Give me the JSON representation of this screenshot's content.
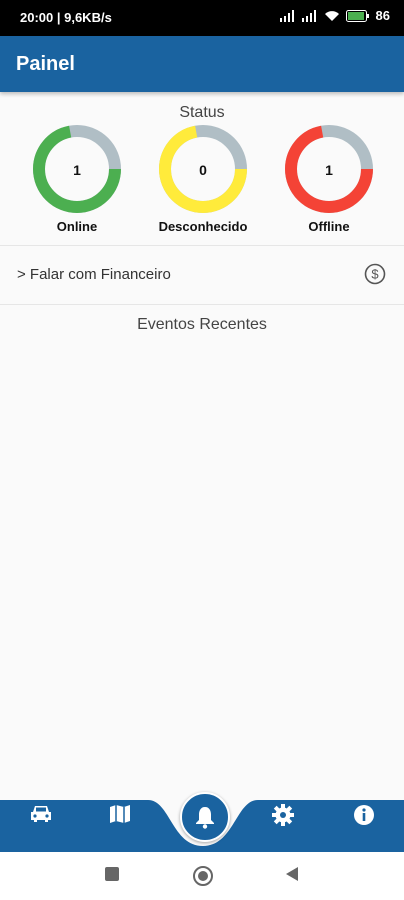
{
  "status_bar": {
    "time": "20:00 | 9,6KB/s",
    "battery": "86"
  },
  "app_bar": {
    "title": "Painel"
  },
  "status_section": {
    "label": "Status",
    "items": [
      {
        "label": "Online",
        "count": "1",
        "color": "#4caf50",
        "fraction": 0.72
      },
      {
        "label": "Desconhecido",
        "count": "0",
        "color": "#ffeb3b",
        "fraction": 0.72
      },
      {
        "label": "Offline",
        "count": "1",
        "color": "#f44336",
        "fraction": 0.72
      }
    ],
    "track_color": "#b0bec5"
  },
  "finance": {
    "text": "> Falar com Financeiro",
    "icon": "dollar-circle-icon"
  },
  "events": {
    "title": "Eventos Recentes"
  },
  "bottom_nav": {
    "background": "#1a63a0",
    "items": [
      {
        "icon": "car-icon"
      },
      {
        "icon": "map-icon"
      },
      {
        "icon": "bell-icon"
      },
      {
        "icon": "gear-icon"
      },
      {
        "icon": "info-icon"
      }
    ]
  },
  "system_nav": [
    "recents-square-icon",
    "home-circle-icon",
    "back-triangle-icon"
  ]
}
